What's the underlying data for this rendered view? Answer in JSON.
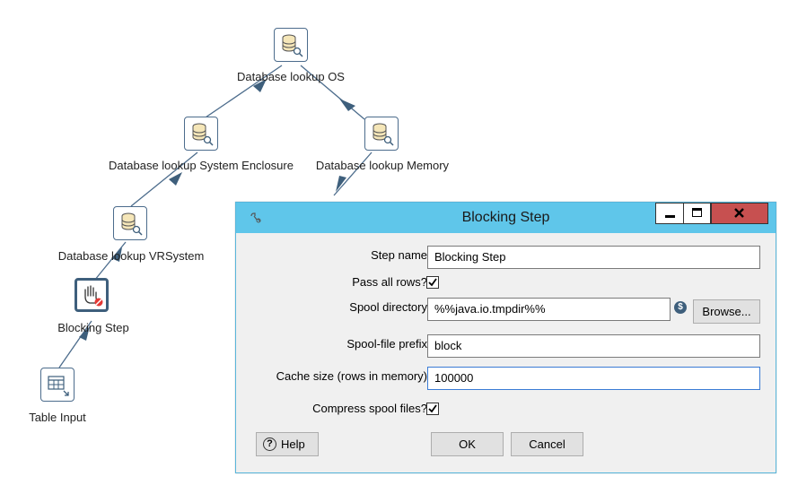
{
  "canvas": {
    "steps": [
      {
        "label": "Database lookup OS",
        "icon": "database-lookup-icon"
      },
      {
        "label": "Database lookup System Enclosure",
        "icon": "database-lookup-icon"
      },
      {
        "label": "Database lookup Memory",
        "icon": "database-lookup-icon"
      },
      {
        "label": "Database lookup VRSystem",
        "icon": "database-lookup-icon"
      },
      {
        "label": "Blocking Step",
        "icon": "blocking-hand-icon"
      },
      {
        "label": "Table Input",
        "icon": "table-input-icon"
      }
    ]
  },
  "dialog": {
    "title": "Blocking Step",
    "app_icon": "kettle-icon",
    "fields": {
      "step_name_label": "Step name",
      "step_name_value": "Blocking Step",
      "pass_all_rows_label": "Pass all rows?",
      "pass_all_rows_checked": true,
      "spool_directory_label": "Spool directory",
      "spool_directory_value": "%%java.io.tmpdir%%",
      "spool_prefix_label": "Spool-file prefix",
      "spool_prefix_value": "block",
      "cache_size_label": "Cache size (rows in memory)",
      "cache_size_value": "100000",
      "compress_label": "Compress spool files?",
      "compress_checked": true
    },
    "buttons": {
      "browse": "Browse...",
      "help": "Help",
      "ok": "OK",
      "cancel": "Cancel"
    },
    "colors": {
      "titlebar": "#5fc6ea",
      "close": "#c75050"
    }
  }
}
